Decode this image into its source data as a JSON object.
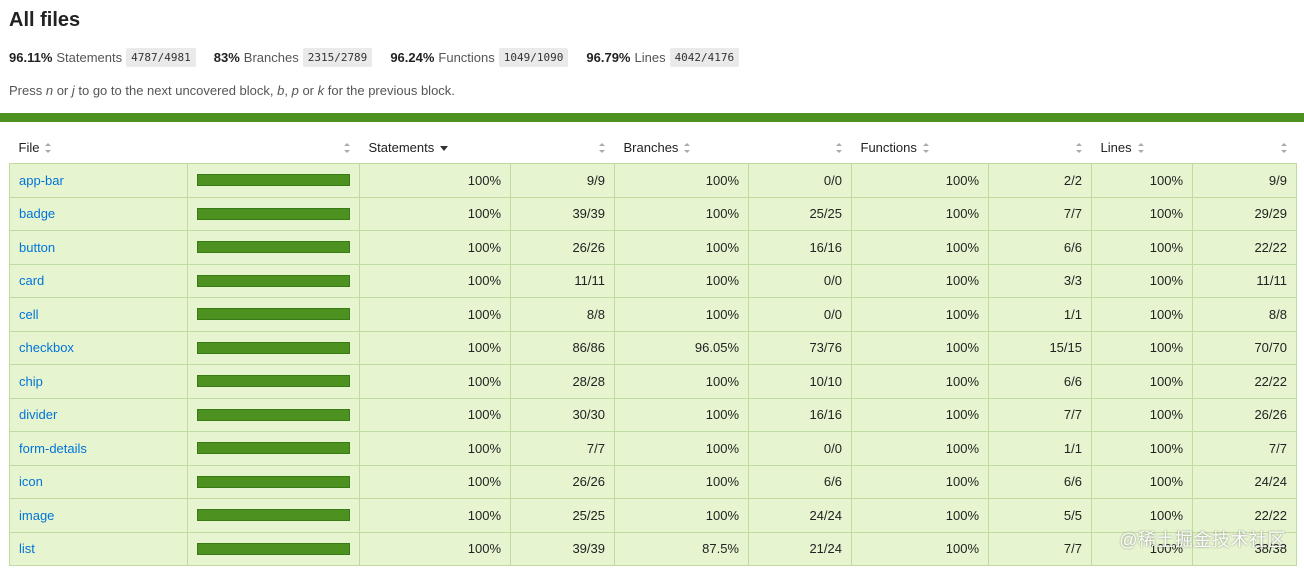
{
  "title": "All files",
  "summary": [
    {
      "pct": "96.11%",
      "label": "Statements",
      "frac": "4787/4981"
    },
    {
      "pct": "83%",
      "label": "Branches",
      "frac": "2315/2789"
    },
    {
      "pct": "96.24%",
      "label": "Functions",
      "frac": "1049/1090"
    },
    {
      "pct": "96.79%",
      "label": "Lines",
      "frac": "4042/4176"
    }
  ],
  "hint": {
    "p1": "Press ",
    "n": "n",
    "p2": " or ",
    "j": "j",
    "p3": " to go to the next uncovered block, ",
    "b": "b",
    "p4": ", ",
    "p": "p",
    "p5": " or ",
    "k": "k",
    "p6": " for the previous block."
  },
  "columns": {
    "file": "File",
    "statements": "Statements",
    "branches": "Branches",
    "functions": "Functions",
    "lines": "Lines"
  },
  "colors": {
    "high_bg": "#e6f5d0",
    "status_green": "#4d9221",
    "link": "#0074d9"
  },
  "rows": [
    {
      "file": "app-bar",
      "coverage": 1.0,
      "stmt_pct": "100%",
      "stmt": "9/9",
      "br_pct": "100%",
      "br": "0/0",
      "fn_pct": "100%",
      "fn": "2/2",
      "ln_pct": "100%",
      "ln": "9/9"
    },
    {
      "file": "badge",
      "coverage": 1.0,
      "stmt_pct": "100%",
      "stmt": "39/39",
      "br_pct": "100%",
      "br": "25/25",
      "fn_pct": "100%",
      "fn": "7/7",
      "ln_pct": "100%",
      "ln": "29/29"
    },
    {
      "file": "button",
      "coverage": 1.0,
      "stmt_pct": "100%",
      "stmt": "26/26",
      "br_pct": "100%",
      "br": "16/16",
      "fn_pct": "100%",
      "fn": "6/6",
      "ln_pct": "100%",
      "ln": "22/22"
    },
    {
      "file": "card",
      "coverage": 1.0,
      "stmt_pct": "100%",
      "stmt": "11/11",
      "br_pct": "100%",
      "br": "0/0",
      "fn_pct": "100%",
      "fn": "3/3",
      "ln_pct": "100%",
      "ln": "11/11"
    },
    {
      "file": "cell",
      "coverage": 1.0,
      "stmt_pct": "100%",
      "stmt": "8/8",
      "br_pct": "100%",
      "br": "0/0",
      "fn_pct": "100%",
      "fn": "1/1",
      "ln_pct": "100%",
      "ln": "8/8"
    },
    {
      "file": "checkbox",
      "coverage": 1.0,
      "stmt_pct": "100%",
      "stmt": "86/86",
      "br_pct": "96.05%",
      "br": "73/76",
      "fn_pct": "100%",
      "fn": "15/15",
      "ln_pct": "100%",
      "ln": "70/70"
    },
    {
      "file": "chip",
      "coverage": 1.0,
      "stmt_pct": "100%",
      "stmt": "28/28",
      "br_pct": "100%",
      "br": "10/10",
      "fn_pct": "100%",
      "fn": "6/6",
      "ln_pct": "100%",
      "ln": "22/22"
    },
    {
      "file": "divider",
      "coverage": 1.0,
      "stmt_pct": "100%",
      "stmt": "30/30",
      "br_pct": "100%",
      "br": "16/16",
      "fn_pct": "100%",
      "fn": "7/7",
      "ln_pct": "100%",
      "ln": "26/26"
    },
    {
      "file": "form-details",
      "coverage": 1.0,
      "stmt_pct": "100%",
      "stmt": "7/7",
      "br_pct": "100%",
      "br": "0/0",
      "fn_pct": "100%",
      "fn": "1/1",
      "ln_pct": "100%",
      "ln": "7/7"
    },
    {
      "file": "icon",
      "coverage": 1.0,
      "stmt_pct": "100%",
      "stmt": "26/26",
      "br_pct": "100%",
      "br": "6/6",
      "fn_pct": "100%",
      "fn": "6/6",
      "ln_pct": "100%",
      "ln": "24/24"
    },
    {
      "file": "image",
      "coverage": 1.0,
      "stmt_pct": "100%",
      "stmt": "25/25",
      "br_pct": "100%",
      "br": "24/24",
      "fn_pct": "100%",
      "fn": "5/5",
      "ln_pct": "100%",
      "ln": "22/22"
    },
    {
      "file": "list",
      "coverage": 1.0,
      "stmt_pct": "100%",
      "stmt": "39/39",
      "br_pct": "87.5%",
      "br": "21/24",
      "fn_pct": "100%",
      "fn": "7/7",
      "ln_pct": "100%",
      "ln": "38/38"
    }
  ],
  "watermark": "@稀土掘金技术社区"
}
